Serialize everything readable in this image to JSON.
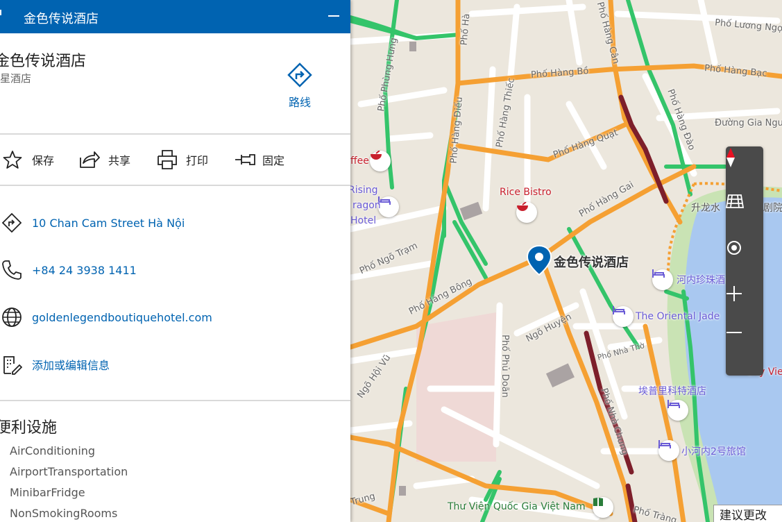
{
  "panel": {
    "window_title": "金色传说酒店",
    "hotel_name": "金色传说酒店",
    "hotel_type": "星酒店",
    "route_label": "路线",
    "actions": [
      {
        "label": "保存",
        "icon": "star-icon"
      },
      {
        "label": "共享",
        "icon": "share-icon"
      },
      {
        "label": "打印",
        "icon": "printer-icon"
      },
      {
        "label": "固定",
        "icon": "pin-icon"
      }
    ],
    "address": "10 Chan Cam Street Hà Nội",
    "phone": "+84 24 3938 1411",
    "website": "goldenlegendboutiquehotel.com",
    "edit_info": "添加或编辑信息",
    "amenities_title": "便利设施",
    "amenities": [
      "AirConditioning",
      "AirportTransportation",
      "MinibarFridge",
      "NonSmokingRooms"
    ]
  },
  "map": {
    "pin_label": "金色传说酒店",
    "feedback_button": "建议更改",
    "street_labels": [
      "Phố Hàng Bồ",
      "Phố Hàng Bạc",
      "Phố Hàng Quạt",
      "Phố Hàng Gai",
      "Phố Hàng Bông",
      "Phố Ngõ Trạm",
      "Ngõ Huyện",
      "Phố Nhà Thờ",
      "Phố Nhà Chung",
      "Phố Phủ Doãn",
      "Phố Hàng Điếu",
      "Phố Hàng Thiếc",
      "Phố Hàng Cân",
      "Phố Hàng Đào",
      "Phố Lương Ngọc",
      "Đường Gia Ngư",
      "Phố Phùng Hưng",
      "Ngõ Hội Vũ",
      "Phố Tràng",
      "Trung",
      "Phố Hà"
    ],
    "pois": [
      {
        "label": "ffee",
        "kind": "food"
      },
      {
        "label": "Rice Bistro",
        "kind": "food"
      },
      {
        "label": "Rising",
        "kind": "hotel"
      },
      {
        "label": "ragon",
        "kind": "hotel"
      },
      {
        "label": "Hotel",
        "kind": "hotel"
      },
      {
        "label": "河内珍珠酒",
        "kind": "hotel"
      },
      {
        "label": "The Oriental Jade",
        "kind": "hotel"
      },
      {
        "label": "埃普里科特酒店",
        "kind": "hotel"
      },
      {
        "label": "小河内2号旅馆",
        "kind": "hotel"
      },
      {
        "label": "City View",
        "kind": "hotel"
      },
      {
        "label": "Thư Viện Quốc Gia Việt Nam",
        "kind": "library"
      },
      {
        "label": "升龙水",
        "kind": "theater"
      },
      {
        "label": "剧院",
        "kind": "theater"
      }
    ],
    "colors": {
      "traffic_free": "#34c46a",
      "traffic_moderate": "#f5a033",
      "traffic_heavy": "#7d1f2b",
      "lake": "#a9c8f0",
      "park": "#c9e3b4",
      "accent": "#0063b1"
    }
  }
}
